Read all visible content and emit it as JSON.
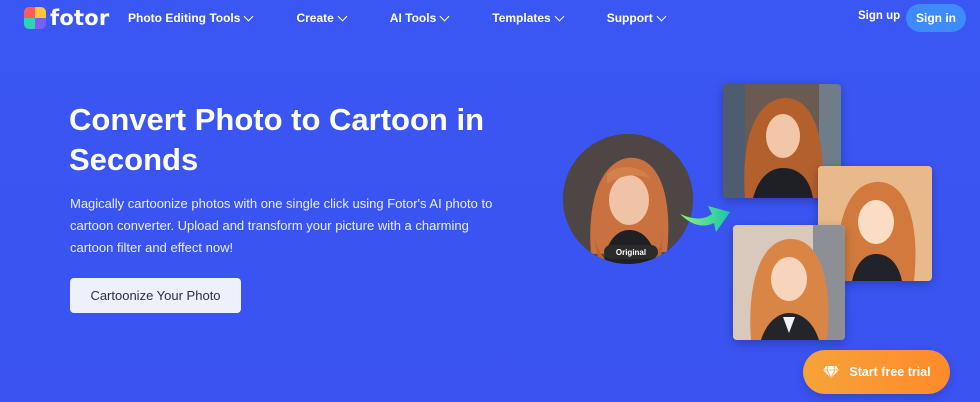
{
  "brand": {
    "name": "fotor"
  },
  "nav": {
    "items": [
      {
        "label": "Photo Editing Tools"
      },
      {
        "label": "Create"
      },
      {
        "label": "AI Tools"
      },
      {
        "label": "Templates"
      },
      {
        "label": "Support"
      }
    ],
    "signup_label": "Sign up",
    "signin_label": "Sign in"
  },
  "hero": {
    "title": "Convert Photo to Cartoon in Seconds",
    "description": "Magically cartoonize photos with one single click using Fotor's AI photo to cartoon converter. Upload and transform your picture with a charming cartoon filter and effect now!",
    "cta_label": "Cartoonize Your Photo"
  },
  "showcase": {
    "original_label": "Original"
  },
  "trial": {
    "label": "Start free trial",
    "icon": "diamond-icon"
  },
  "colors": {
    "background": "#3a55f2",
    "signin_bg": "#3d8bff",
    "trial_gradient_start": "#f6a33a",
    "trial_gradient_end": "#ff8a2a",
    "arrow_gradient_start": "#8ff27a",
    "arrow_gradient_end": "#19c6a8"
  }
}
